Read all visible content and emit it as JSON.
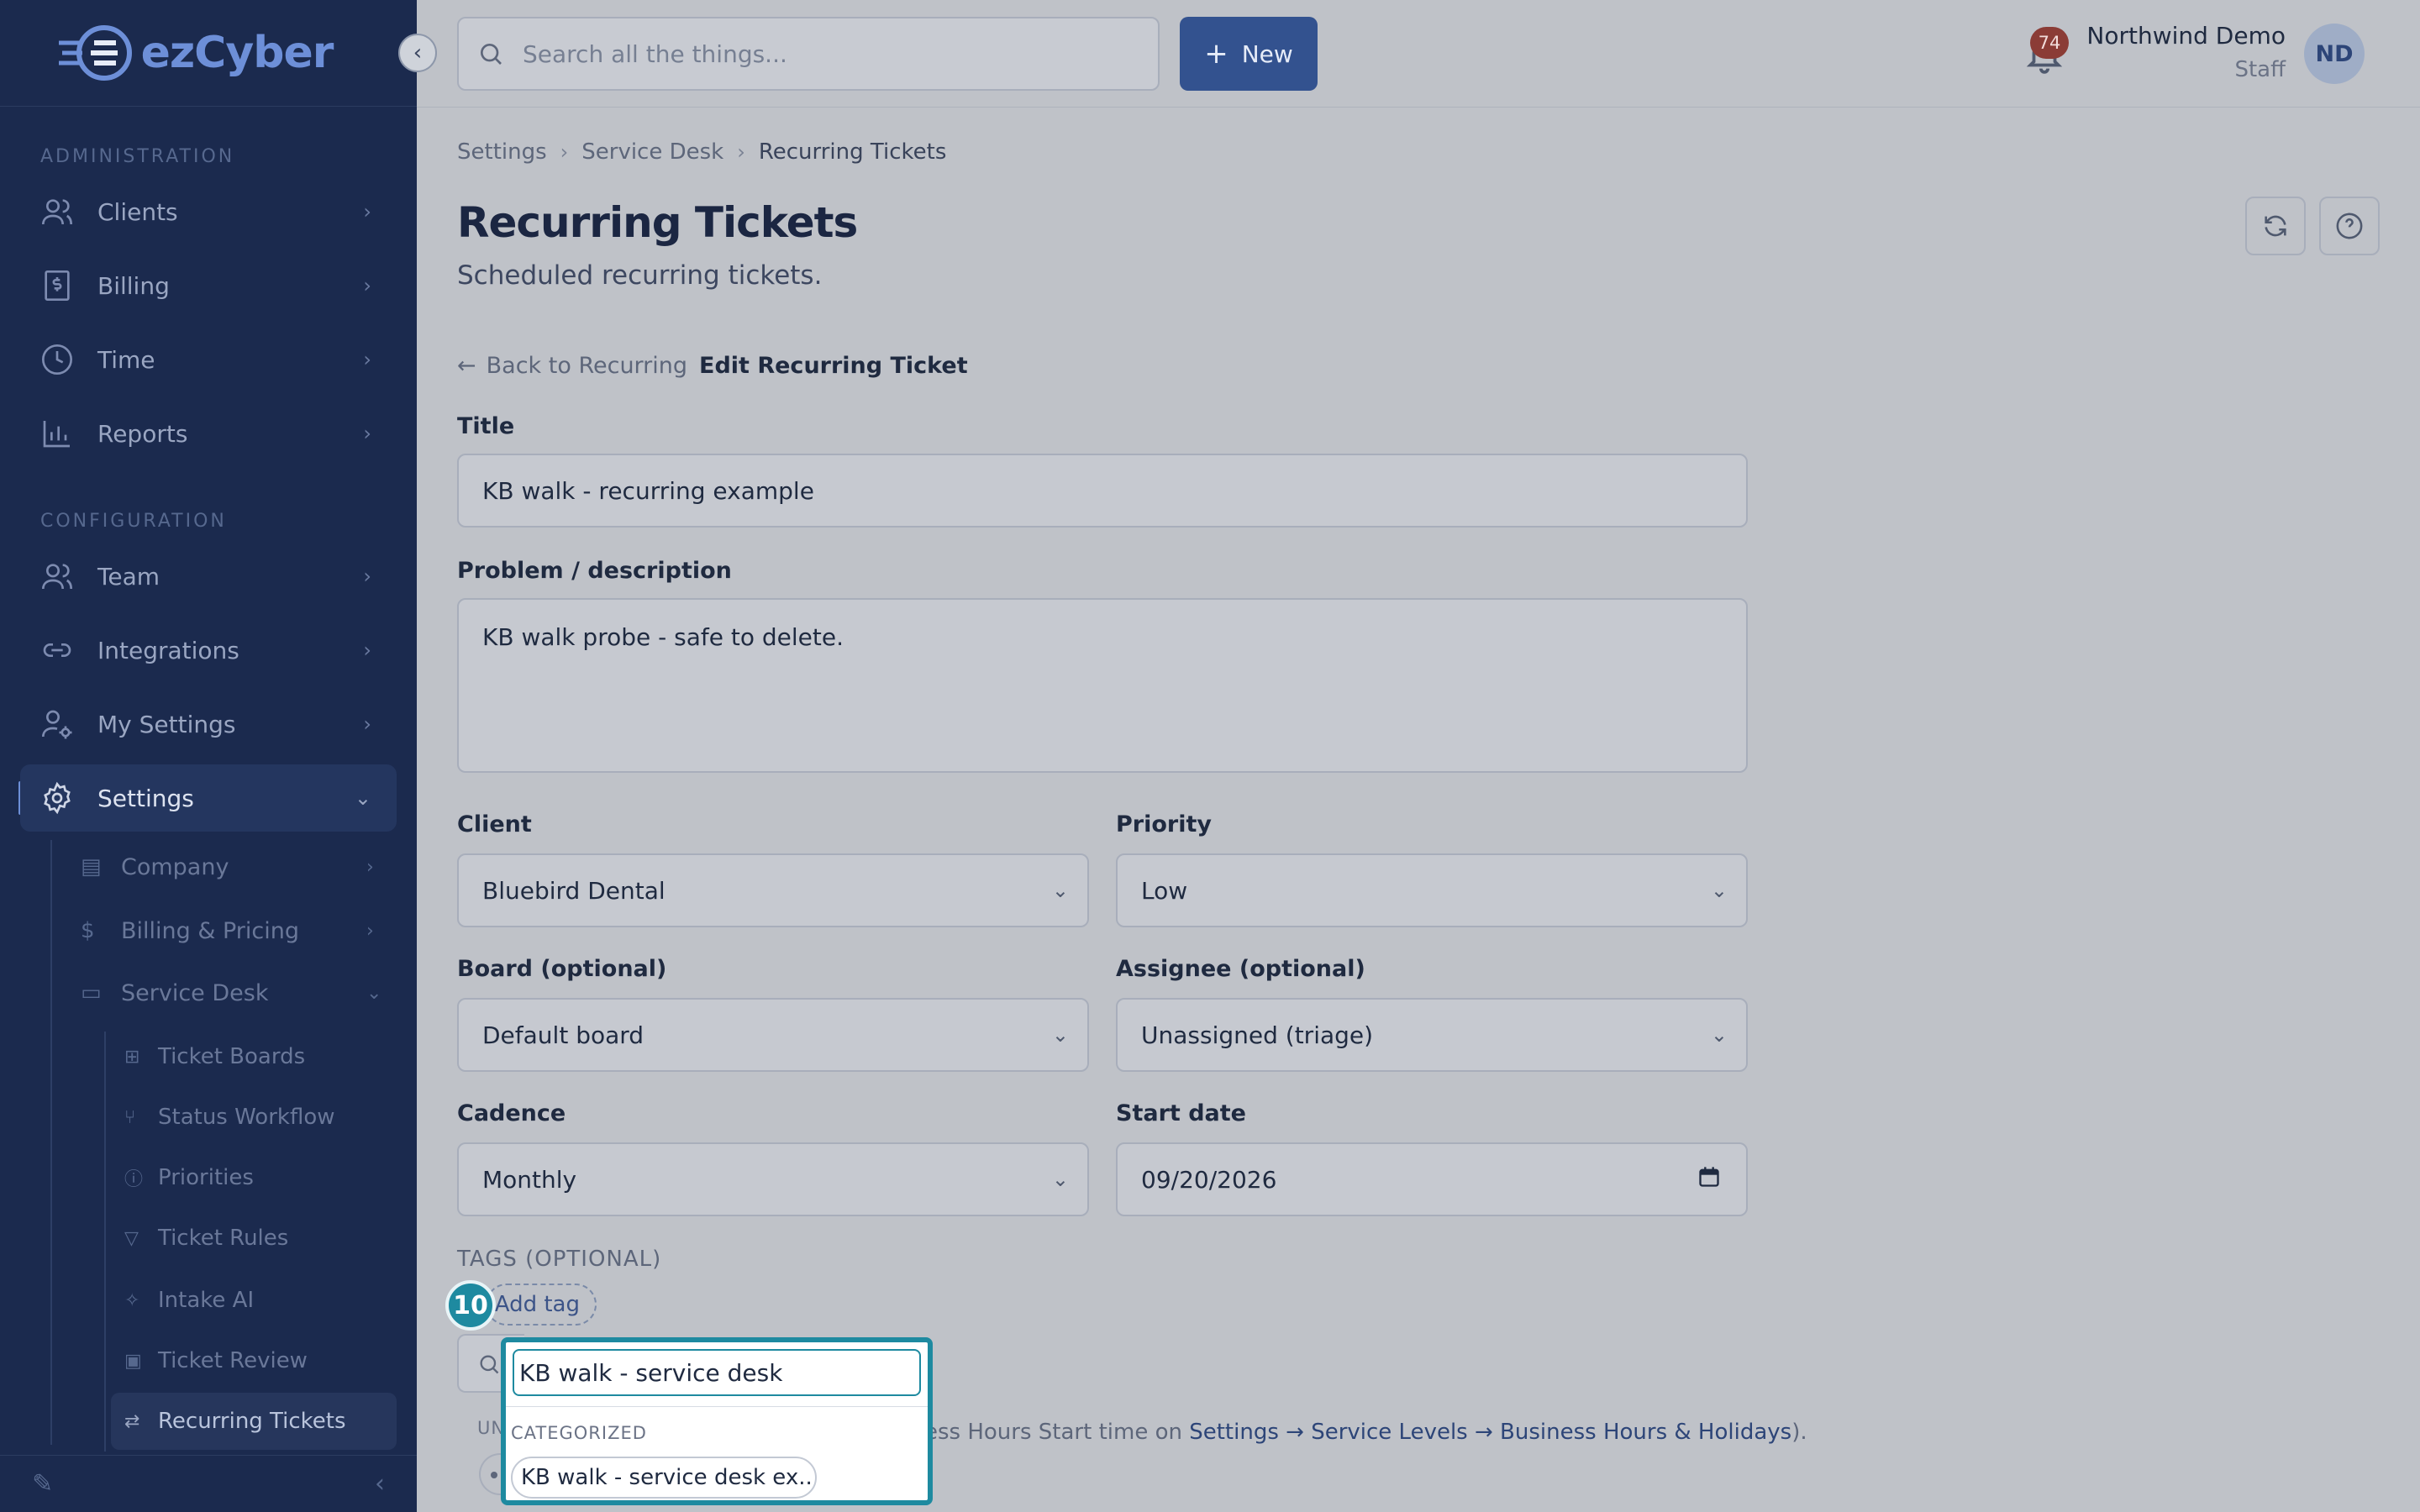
{
  "brand": {
    "name": "ezCyber",
    "accent": "#6d8fd8"
  },
  "sidebar": {
    "sections": [
      "ADMINISTRATION",
      "CONFIGURATION"
    ],
    "admin_items": [
      {
        "label": "Clients",
        "icon": "users-icon"
      },
      {
        "label": "Billing",
        "icon": "dollar-receipt-icon"
      },
      {
        "label": "Time",
        "icon": "clock-icon"
      },
      {
        "label": "Reports",
        "icon": "bar-chart-icon"
      }
    ],
    "config_items": [
      {
        "label": "Team",
        "icon": "users-icon"
      },
      {
        "label": "Integrations",
        "icon": "link-icon"
      },
      {
        "label": "My Settings",
        "icon": "user-gear-icon"
      },
      {
        "label": "Settings",
        "icon": "gear-icon"
      }
    ],
    "settings_children": [
      {
        "label": "Company",
        "icon": "building-icon"
      },
      {
        "label": "Billing & Pricing",
        "icon": "dollar-icon"
      },
      {
        "label": "Service Desk",
        "icon": "ticket-icon"
      }
    ],
    "service_desk_children": [
      {
        "label": "Ticket Boards",
        "icon": "grid-icon"
      },
      {
        "label": "Status Workflow",
        "icon": "workflow-icon"
      },
      {
        "label": "Priorities",
        "icon": "alert-circle-icon"
      },
      {
        "label": "Ticket Rules",
        "icon": "filter-icon"
      },
      {
        "label": "Intake AI",
        "icon": "sparkle-icon"
      },
      {
        "label": "Ticket Review",
        "icon": "clipboard-icon"
      },
      {
        "label": "Recurring Tickets",
        "icon": "repeat-icon"
      }
    ]
  },
  "topbar": {
    "search_placeholder": "Search all the things...",
    "new_label": "New",
    "notification_count": "74",
    "user_name": "Northwind Demo",
    "user_role": "Staff",
    "user_initials": "ND"
  },
  "breadcrumb": [
    "Settings",
    "Service Desk",
    "Recurring Tickets"
  ],
  "page": {
    "title": "Recurring Tickets",
    "subtitle": "Scheduled recurring tickets.",
    "back_label": "Back to Recurring",
    "edit_label": "Edit Recurring Ticket"
  },
  "form": {
    "title_label": "Title",
    "title_value": "KB walk - recurring example",
    "description_label": "Problem / description",
    "description_value": "KB walk probe - safe to delete.",
    "client_label": "Client",
    "client_value": "Bluebird Dental",
    "priority_label": "Priority",
    "priority_value": "Low",
    "board_label": "Board (optional)",
    "board_value": "Default board",
    "assignee_label": "Assignee (optional)",
    "assignee_value": "Unassigned (triage)",
    "cadence_label": "Cadence",
    "cadence_value": "Monthly",
    "start_label": "Start date",
    "start_value": "09/20/2026",
    "tags_label": "TAGS (OPTIONAL)",
    "add_tag_label": "Add tag",
    "hint_prefix": "ess Hours Start time on ",
    "hint_link": "Settings → Service Levels → Business Hours & Holidays",
    "hint_suffix": ")."
  },
  "tag_popup": {
    "step_number": "10",
    "search_value": "KB walk - service desk",
    "category_prefix": "UN",
    "category_rest": "CATEGORIZED",
    "option_label": "KB walk - service desk ex..."
  }
}
